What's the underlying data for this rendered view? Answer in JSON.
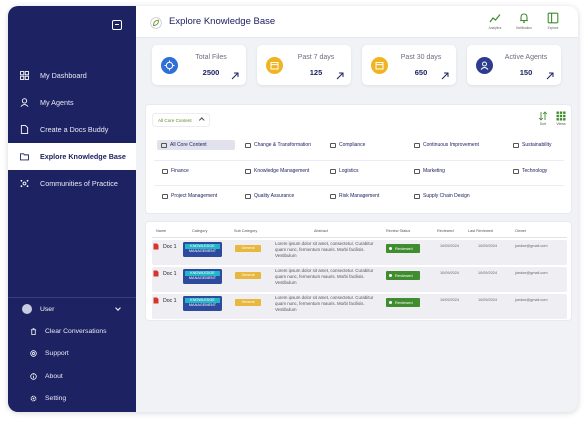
{
  "app": {
    "title": "Explore Knowledge Base"
  },
  "sidebar": {
    "items": [
      {
        "label": "My Dashboard",
        "icon": "dashboard-icon"
      },
      {
        "label": "My Agents",
        "icon": "agent-icon"
      },
      {
        "label": "Create a Docs Buddy",
        "icon": "document-icon"
      },
      {
        "label": "Explore Knowledge Base",
        "icon": "folder-icon",
        "active": true
      },
      {
        "label": "Communities of Practice",
        "icon": "community-icon"
      }
    ],
    "user": {
      "label": "User"
    },
    "bottom_items": [
      {
        "label": "Clear Conversations",
        "icon": "trash-icon"
      },
      {
        "label": "Support",
        "icon": "support-icon"
      },
      {
        "label": "About",
        "icon": "info-icon"
      },
      {
        "label": "Setting",
        "icon": "gear-icon"
      }
    ]
  },
  "header": {
    "buttons": [
      {
        "label": "Analytics",
        "icon": "chart-icon"
      },
      {
        "label": "Notification",
        "icon": "bell-icon"
      },
      {
        "label": "Explore",
        "icon": "panel-icon"
      }
    ]
  },
  "stats": [
    {
      "label": "Total Files",
      "value": "2500",
      "icon": "files-icon",
      "color": "#2f6fd6"
    },
    {
      "label": "Past 7 days",
      "value": "125",
      "icon": "calendar-icon",
      "color": "#f0b321"
    },
    {
      "label": "Past 30 days",
      "value": "650",
      "icon": "calendar-icon",
      "color": "#f0b321"
    },
    {
      "label": "Active Agents",
      "value": "150",
      "icon": "agent-icon",
      "color": "#2e3b8f"
    }
  ],
  "filter": {
    "dropdown_value": "All Core Content",
    "tools": [
      {
        "label": "Sort"
      },
      {
        "label": "Views"
      }
    ],
    "categories": [
      "All Core Content",
      "Change & Transformation",
      "Compliance",
      "Continuous Improvement",
      "Sustainability",
      "Finance",
      "Knowledge Management",
      "Logistics",
      "Marketing",
      "Technology",
      "Project Management",
      "Quality Assurance",
      "Risk Management",
      "Supply Chain Design"
    ]
  },
  "table": {
    "headers": [
      "Name",
      "Category",
      "Sub Category",
      "Abstract",
      "Review Status",
      "Reviewed",
      "Last Reviewed",
      "Owner"
    ],
    "rows": [
      {
        "name": "Doc 1",
        "category_line1": "KNOWLEDGE",
        "category_line2": "MANAGEMENT",
        "sub_category": "General",
        "abstract": "Lorem ipsum dolor sit amet, consectetur. Curabitur quam nunc, fermentum mauris. Morbi facilisis. Vestibulum",
        "status": "Reviewed",
        "reviewed": "10/09/2024",
        "last_reviewed": "10/09/2024",
        "owner": "joedoe@gmail.com"
      },
      {
        "name": "Doc 1",
        "category_line1": "KNOWLEDGE",
        "category_line2": "MANAGEMENT",
        "sub_category": "General",
        "abstract": "Lorem ipsum dolor sit amet, consectetur. Curabitur quam nunc, fermentum mauris. Morbi facilisis. Vestibulum",
        "status": "Reviewed",
        "reviewed": "10/09/2024",
        "last_reviewed": "10/09/2024",
        "owner": "joedoe@gmail.com"
      },
      {
        "name": "Doc 1",
        "category_line1": "KNOWLEDGE",
        "category_line2": "MANAGEMENT",
        "sub_category": "General",
        "abstract": "Lorem ipsum dolor sit amet, consectetur. Curabitur quam nunc, fermentum mauris. Morbi facilisis. Vestibulum",
        "status": "Reviewed",
        "reviewed": "10/09/2024",
        "last_reviewed": "10/09/2024",
        "owner": "joedoe@gmail.com"
      }
    ]
  },
  "colors": {
    "sidebar": "#1d2262",
    "accent_green": "#3f8d2e",
    "category_badge": "#2e4a9e",
    "sub_badge": "#e8b73d"
  }
}
